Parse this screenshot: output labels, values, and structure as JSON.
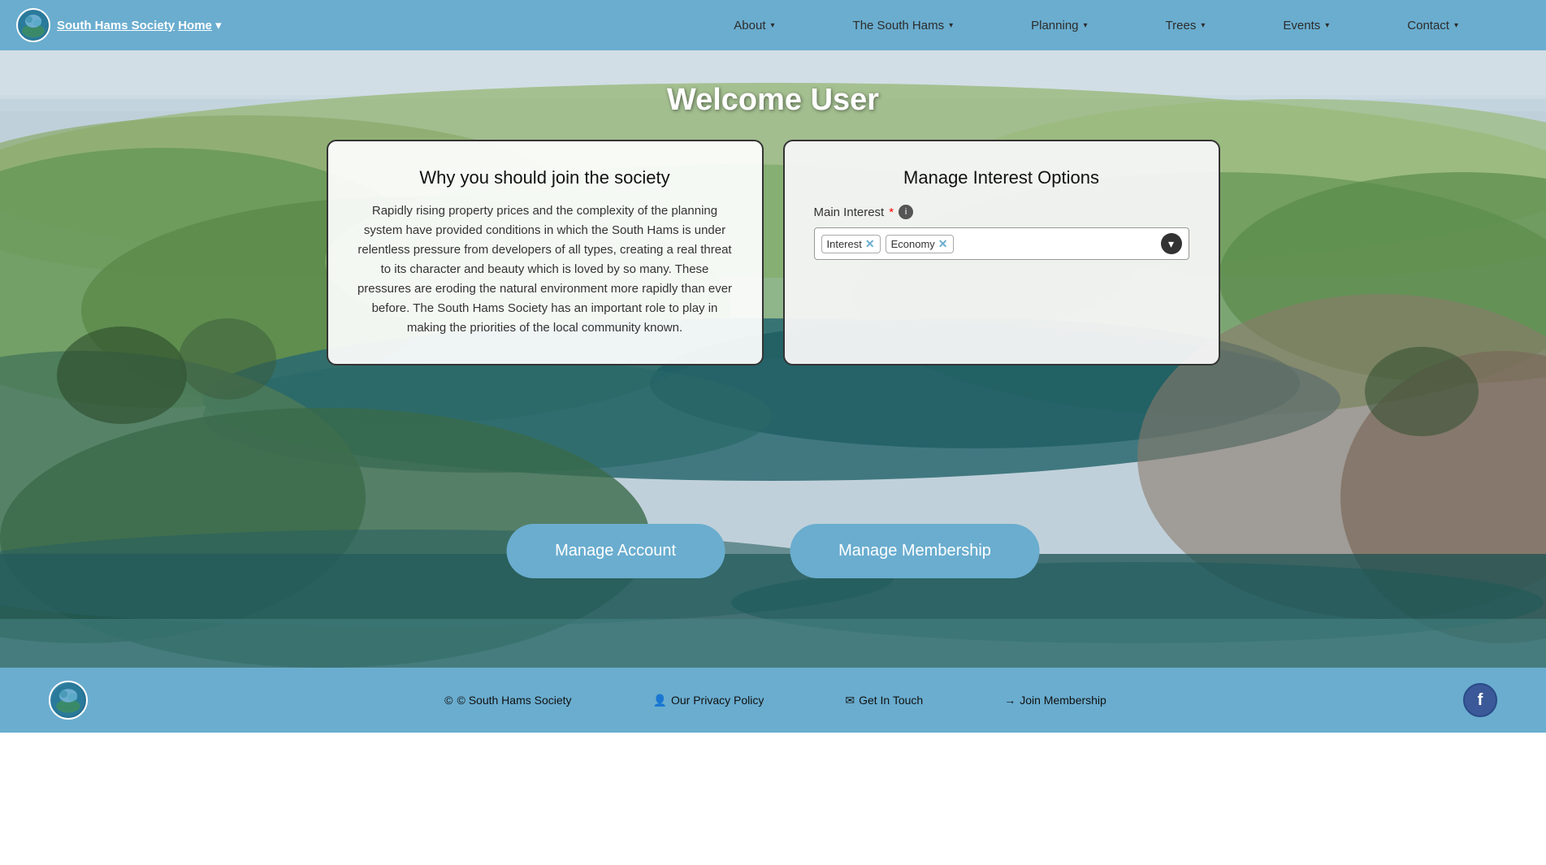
{
  "nav": {
    "brand": "South Hams Society",
    "home_label": "Home",
    "logo_alt": "South Hams Society Logo",
    "links": [
      {
        "label": "About",
        "has_dropdown": true
      },
      {
        "label": "The South Hams",
        "has_dropdown": true
      },
      {
        "label": "Planning",
        "has_dropdown": true
      },
      {
        "label": "Trees",
        "has_dropdown": true
      },
      {
        "label": "Events",
        "has_dropdown": true
      },
      {
        "label": "Contact",
        "has_dropdown": true
      }
    ]
  },
  "hero": {
    "welcome": "Welcome User"
  },
  "card_left": {
    "title": "Why you should join the society",
    "body": "Rapidly rising property prices and the complexity of the planning system have provided conditions in which the South Hams is under relentless pressure from developers of all types, creating a real threat to its character and beauty which is loved by so many. These pressures are eroding the natural environment more rapidly than ever before. The South Hams Society has an important role to play in making the priorities of the local community known."
  },
  "card_right": {
    "title": "Manage Interest Options",
    "interest_label": "Main Interest",
    "required": "*",
    "tags": [
      {
        "label": "Interest"
      },
      {
        "label": "Economy"
      }
    ]
  },
  "buttons": {
    "manage_account": "Manage Account",
    "manage_membership": "Manage Membership"
  },
  "footer": {
    "copyright": "© South Hams Society",
    "privacy": "Our Privacy Policy",
    "contact": "Get In Touch",
    "join": "Join Membership"
  }
}
